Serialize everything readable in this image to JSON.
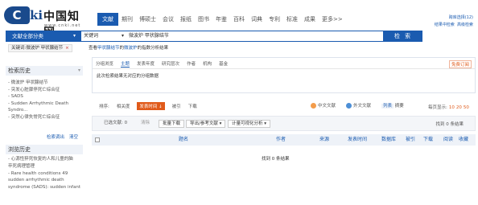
{
  "logo": {
    "c": "C",
    "ki": "ki",
    "cn": "中国知网",
    "url": "www.cnki.net"
  },
  "nav": [
    "文献",
    "期刊",
    "博硕士",
    "会议",
    "报纸",
    "图书",
    "年鉴",
    "百科",
    "词典",
    "专利",
    "标准",
    "成果",
    "更多>>"
  ],
  "top_links": {
    "a": "跨库选择(12)",
    "b": "结果中检索",
    "c": "高级检索"
  },
  "search": {
    "category": "文献全部分类",
    "field": "关键词",
    "value": "微波炉 甲状腺结节",
    "button": "检 索"
  },
  "crumb": {
    "tag": "关键词:微波炉 甲状腺结节",
    "close": "×",
    "prefix": "查看",
    "term": "甲状腺结节",
    "infix": "的",
    "term2": "微波炉",
    "suffix": "的指数分析结果"
  },
  "sidebar": {
    "history_title": "检索历史",
    "history": [
      "- 微波炉 甲状腺结节",
      "- 突发心脏骤停死亡综合征",
      "- SADS",
      "- Sudden Arrhythmic Death",
      "  Syndro...",
      "- 突然心律失常死亡综合征"
    ],
    "actions": [
      "检索调出",
      "清空"
    ],
    "browse_title": "浏览历史",
    "browse": [
      "- 心源性猝死恢复的人和儿童的脑",
      "  卒死病理管理",
      "- Rare health conditions 49",
      "  sudden arrhythmic death",
      "  syndrome (SADS): sudden infant"
    ]
  },
  "grouping": {
    "tabs": [
      "分组浏览",
      "主题",
      "发表年度",
      "研究层次",
      "作者",
      "机构",
      "基金"
    ],
    "active_tab": "主题",
    "empty": "此次检索结果无对应的分组数据",
    "viz": "免费订阅"
  },
  "sort": {
    "label": "排序:",
    "items": [
      "相关度",
      "发表时间 ↓",
      "被引",
      "下载"
    ],
    "active": "发表时间 ↓",
    "lang_zh": "中文文献",
    "lang_en": "外文文献",
    "view_list": "列表",
    "view_abstract": "摘要",
    "per_page_label": "每页显示:",
    "per_page": [
      "10",
      "20",
      "50"
    ]
  },
  "actions": {
    "selected": "已选文献: 0",
    "clear": "清除",
    "batch_download": "批量下载",
    "export": "导出/参考文献",
    "analysis": "计量可视化分析",
    "chev": "▾",
    "found": "找到 0 条结果"
  },
  "table": {
    "cols": [
      "题名",
      "作者",
      "来源",
      "发表时间",
      "数据库",
      "被引",
      "下载",
      "阅读",
      "收藏"
    ]
  },
  "no_result": "找到 0 条结果",
  "colors": {
    "primary": "#1a5bb0",
    "accent": "#e05a1a"
  }
}
